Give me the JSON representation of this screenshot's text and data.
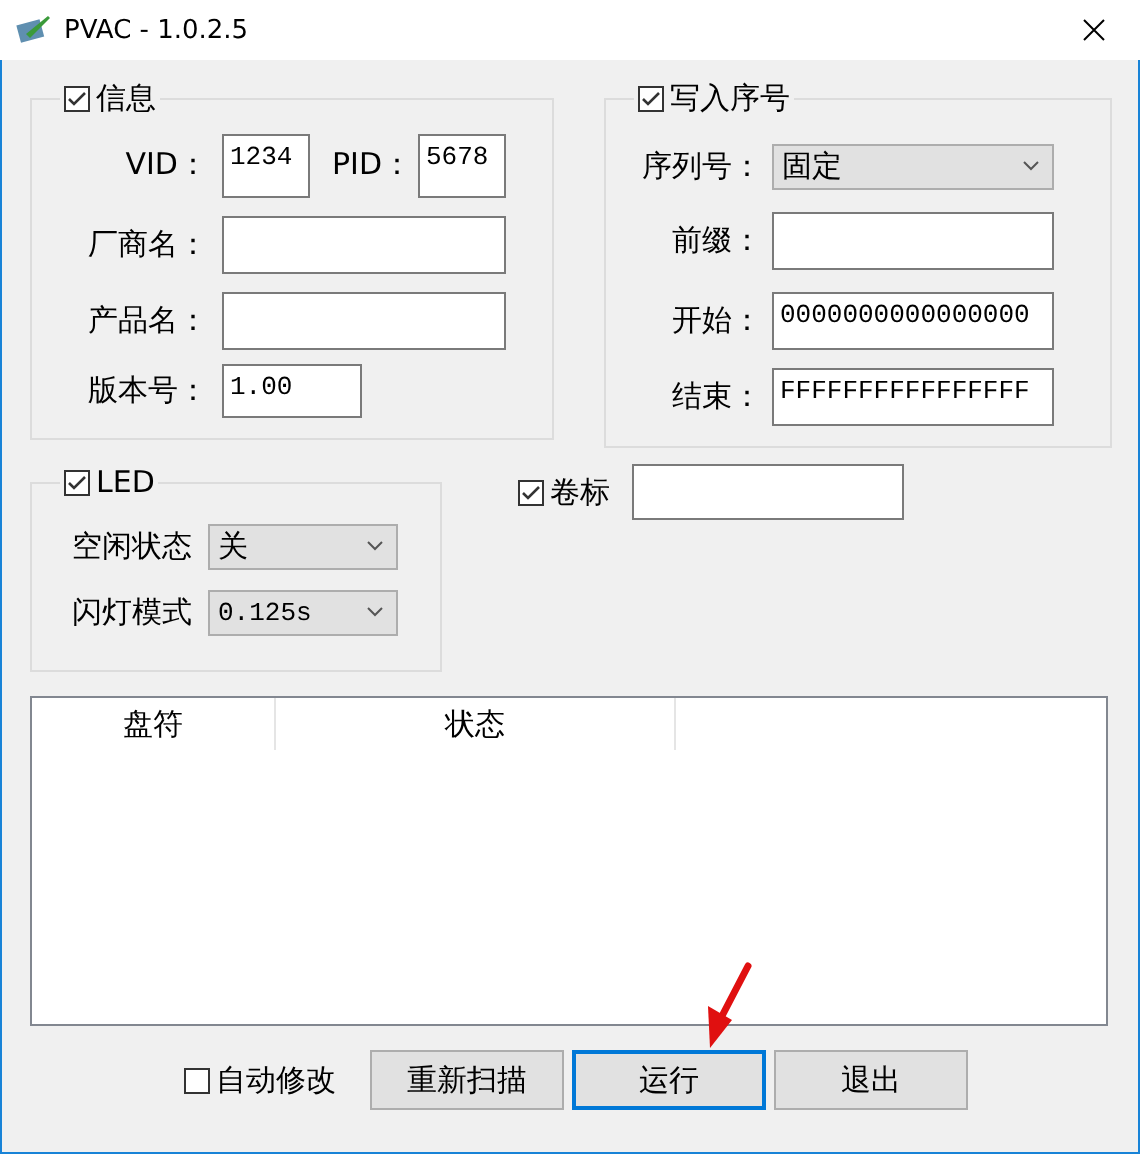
{
  "window": {
    "title": "PVAC - 1.0.2.5"
  },
  "info": {
    "label": "信息",
    "checked": true,
    "rows": [
      {
        "kind": "pair",
        "items": [
          {
            "label": "VID：",
            "value": "1234"
          },
          {
            "label": "PID：",
            "value": "5678"
          }
        ]
      },
      {
        "kind": "field",
        "label": "厂商名："
      },
      {
        "kind": "field",
        "label": "产品名："
      },
      {
        "kind": "short",
        "label": "版本号：",
        "value": "1.00"
      }
    ]
  },
  "serial": {
    "label": "写入序号",
    "checked": true,
    "rows": [
      {
        "kind": "combo",
        "label": "序列号：",
        "value": "固定"
      },
      {
        "kind": "field",
        "label": "前缀："
      },
      {
        "kind": "field",
        "label": "开始：",
        "value": "0000000000000000"
      },
      {
        "kind": "field",
        "label": "结束：",
        "value": "FFFFFFFFFFFFFFFF"
      }
    ]
  },
  "led": {
    "label": "LED",
    "checked": true,
    "rows": [
      {
        "label": "空闲状态",
        "value": "关"
      },
      {
        "label": "闪灯模式",
        "value": "0.125s"
      }
    ]
  },
  "volume": {
    "label": "卷标",
    "checked": true
  },
  "list": {
    "columns": [
      "盘符",
      "状态"
    ]
  },
  "auto_fix": {
    "label": "自动修改",
    "checked": false
  },
  "buttons": [
    {
      "label": "重新扫描",
      "focused": false
    },
    {
      "label": "运行",
      "focused": true
    },
    {
      "label": "退出",
      "focused": false
    }
  ]
}
